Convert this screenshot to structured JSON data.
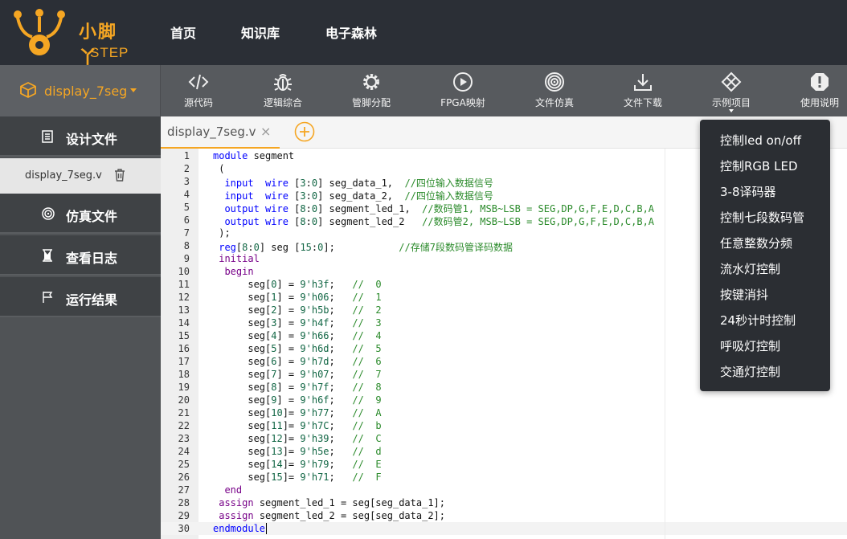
{
  "header": {
    "logo_text": "小脚丫",
    "logo_sub": "STEP",
    "nav": [
      "首页",
      "知识库",
      "电子森林"
    ]
  },
  "project": {
    "name": "display_7seg",
    "icon": "cube-icon"
  },
  "toolbar": [
    {
      "label": "源代码",
      "icon": "code-icon"
    },
    {
      "label": "逻辑综合",
      "icon": "bug-icon"
    },
    {
      "label": "管脚分配",
      "icon": "gear-icon"
    },
    {
      "label": "FPGA映射",
      "icon": "play-icon"
    },
    {
      "label": "文件仿真",
      "icon": "target-icon"
    },
    {
      "label": "文件下载",
      "icon": "download-icon"
    },
    {
      "label": "示例项目",
      "icon": "diamond-grid-icon"
    },
    {
      "label": "使用说明",
      "icon": "alert-icon"
    }
  ],
  "sidebar": {
    "design_files": "设计文件",
    "current_file": "display_7seg.v",
    "sim_files": "仿真文件",
    "log": "查看日志",
    "results": "运行结果"
  },
  "editor": {
    "tab": "display_7seg.v",
    "tab_close": "×",
    "line_numbers": [
      "1",
      "2",
      "3",
      "4",
      "5",
      "6",
      "7",
      "8",
      "9",
      "10",
      "11",
      "12",
      "13",
      "14",
      "15",
      "16",
      "17",
      "18",
      "19",
      "20",
      "21",
      "22",
      "23",
      "24",
      "25",
      "26",
      "27",
      "28",
      "29",
      "30"
    ]
  },
  "examples": [
    "控制led on/off",
    "控制RGB LED",
    "3-8译码器",
    "控制七段数码管",
    "任意整数分频",
    "流水灯控制",
    "按键消抖",
    "24秒计时控制",
    "呼吸灯控制",
    "交通灯控制"
  ],
  "colors": {
    "accent": "#f5a623",
    "header_bg": "#2b2f36",
    "toolbar_bg": "#575a5e",
    "sidebar_bg": "#3f4245"
  }
}
